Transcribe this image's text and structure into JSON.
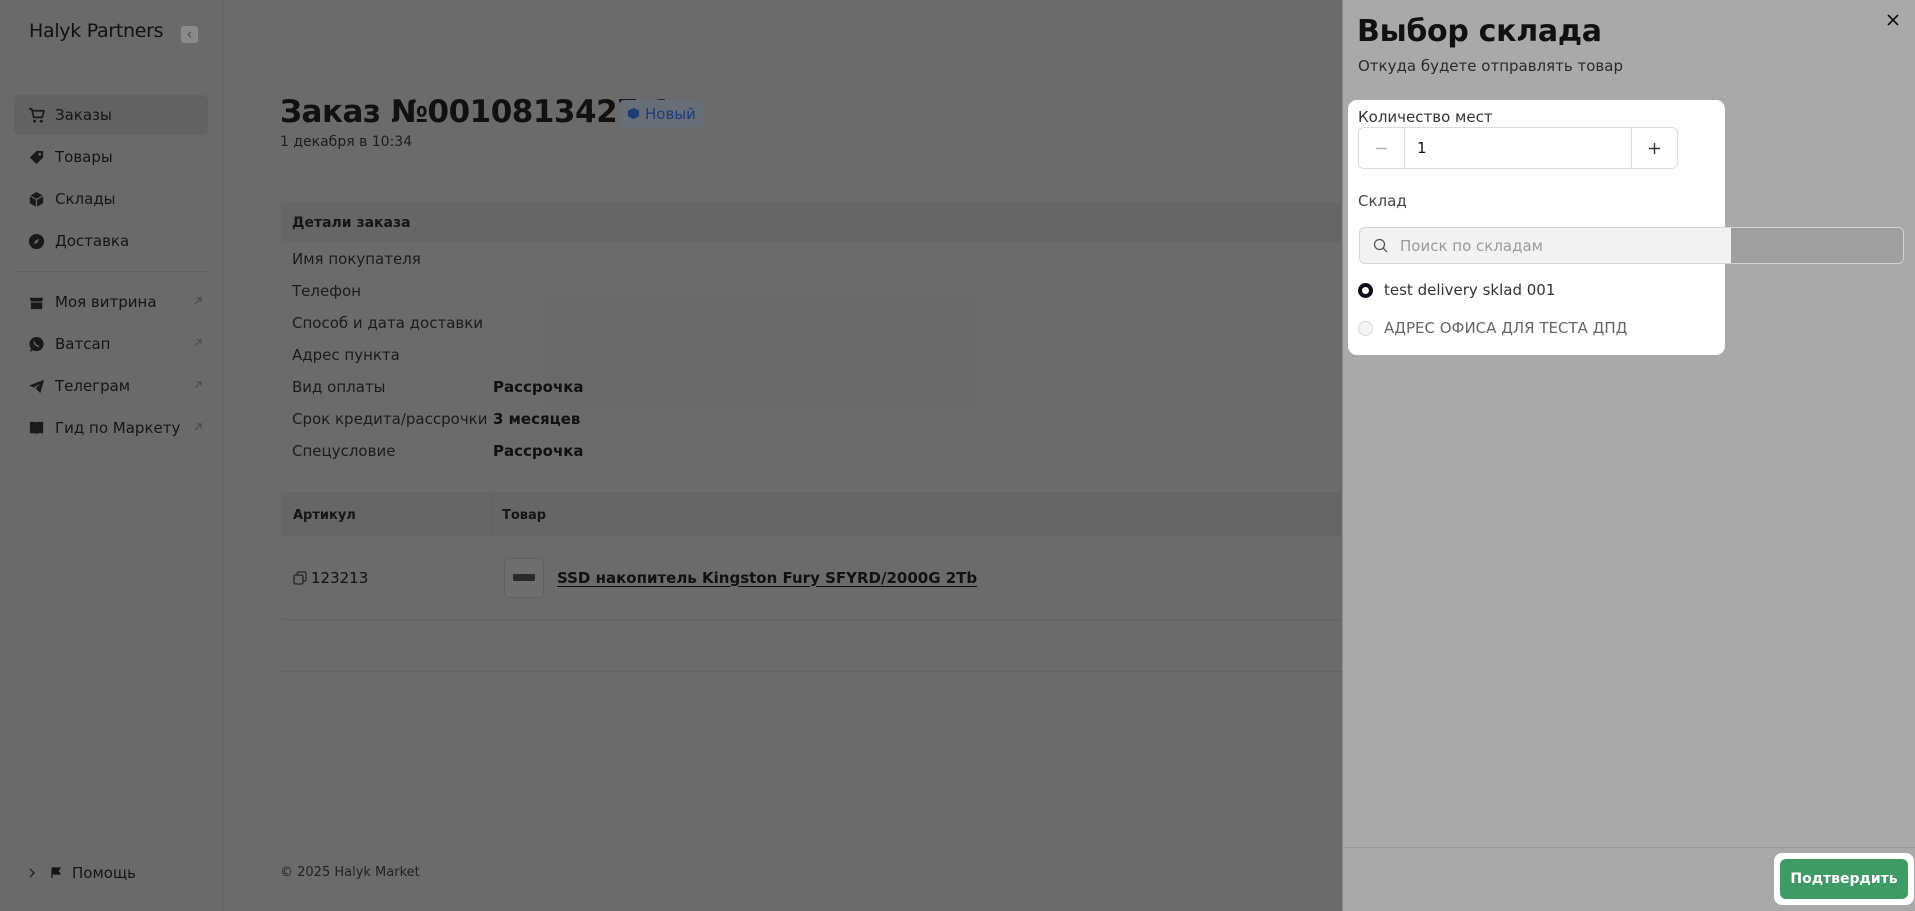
{
  "app": {
    "brand": "Halyk Partners"
  },
  "sidebar": {
    "items": [
      {
        "label": "Заказы",
        "icon": "cart-icon",
        "active": true,
        "external": false
      },
      {
        "label": "Товары",
        "icon": "tag-icon",
        "active": false,
        "external": false
      },
      {
        "label": "Склады",
        "icon": "box-icon",
        "active": false,
        "external": false
      },
      {
        "label": "Доставка",
        "icon": "compass-icon",
        "active": false,
        "external": false
      },
      {
        "label": "Моя витрина",
        "icon": "store-icon",
        "active": false,
        "external": true
      },
      {
        "label": "Ватсап",
        "icon": "whatsapp-icon",
        "active": false,
        "external": true
      },
      {
        "label": "Телеграм",
        "icon": "telegram-icon",
        "active": false,
        "external": true
      },
      {
        "label": "Гид по Маркету",
        "icon": "book-icon",
        "active": false,
        "external": true
      }
    ],
    "help_label": "Помощь"
  },
  "order": {
    "title": "Заказ №0010813427-1",
    "status": "Новый",
    "date": "1 декабря в 10:34"
  },
  "details": {
    "heading": "Детали заказа",
    "rows": [
      {
        "label": "Имя покупателя",
        "value": ""
      },
      {
        "label": "Телефон",
        "value": ""
      },
      {
        "label": "Способ и дата доставки",
        "value": ""
      },
      {
        "label": "Адрес пункта",
        "value": ""
      },
      {
        "label": "Вид оплаты",
        "value": "Рассрочка"
      },
      {
        "label": "Срок кредита/рассрочки",
        "value": "3 месяцев"
      },
      {
        "label": "Спецусловие",
        "value": "Рассрочка"
      }
    ]
  },
  "goods": {
    "headers": [
      "Артикул",
      "Товар"
    ],
    "rows": [
      {
        "sku": "123213",
        "product": "SSD накопитель Kingston Fury SFYRD/2000G 2Tb"
      }
    ]
  },
  "footer": {
    "copyright": "© 2025 Halyk Market"
  },
  "drawer": {
    "title": "Выбор склада",
    "subtitle": "Откуда будете отправлять товар",
    "quantity_label": "Количество мест",
    "quantity_value": "1",
    "warehouse_label": "Склад",
    "search_placeholder": "Поиск по складам",
    "warehouses": [
      {
        "name": "test delivery sklad 001",
        "selected": true
      },
      {
        "name": "АДРЕС ОФИСА ДЛЯ ТЕСТА ДПД",
        "selected": false
      }
    ],
    "confirm_label": "Подтвердить"
  },
  "colors": {
    "accent_green": "#3f9b66",
    "badge_text": "#1d3c78",
    "overlay": "#6b6b6b"
  }
}
